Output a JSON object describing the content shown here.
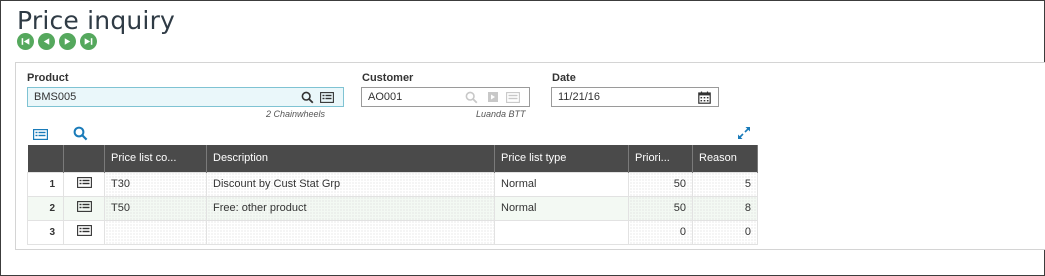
{
  "page": {
    "title": "Price inquiry"
  },
  "nav": {
    "icons": [
      "first-icon",
      "previous-icon",
      "next-icon",
      "last-icon"
    ]
  },
  "form": {
    "product": {
      "label": "Product",
      "value": "BMS005",
      "description": "2 Chainwheels"
    },
    "customer": {
      "label": "Customer",
      "value": "AO001",
      "description": "Luanda BTT"
    },
    "date": {
      "label": "Date",
      "value": "11/21/16"
    }
  },
  "grid": {
    "columns": [
      "Price list co...",
      "Description",
      "Price list type",
      "Priori...",
      "Reason"
    ],
    "rows": [
      {
        "num": "1",
        "code": "T30",
        "description": "Discount by Cust Stat Grp",
        "type": "Normal",
        "priority": "50",
        "reason": "5"
      },
      {
        "num": "2",
        "code": "T50",
        "description": "Free: other product",
        "type": "Normal",
        "priority": "50",
        "reason": "8"
      },
      {
        "num": "3",
        "code": "",
        "description": "",
        "type": "",
        "priority": "0",
        "reason": "0"
      }
    ]
  },
  "colors": {
    "accent_green": "#55a85d",
    "header_dark": "#4a4a4a",
    "link_blue": "#1a7bb9"
  }
}
